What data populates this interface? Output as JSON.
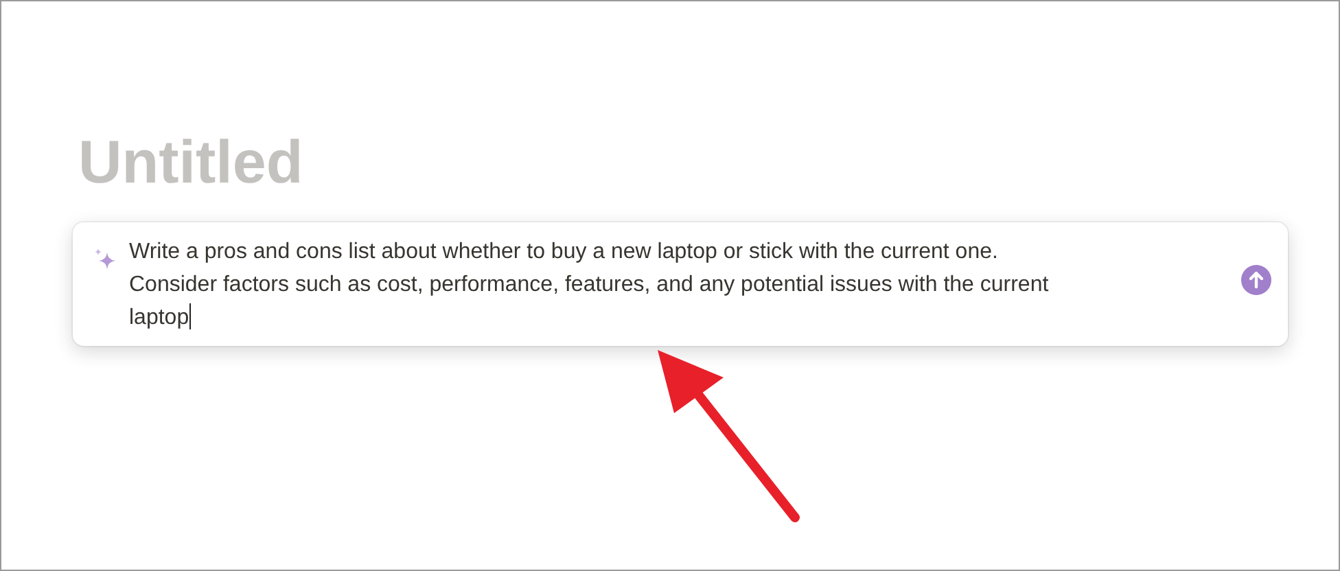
{
  "page": {
    "title_placeholder": "Untitled"
  },
  "prompt": {
    "value": "Write a pros and cons list about whether to buy a new laptop or stick with the current one. Consider factors such as cost, performance, features, and any potential issues with the current laptop"
  },
  "annotation": {
    "kind": "arrow"
  }
}
